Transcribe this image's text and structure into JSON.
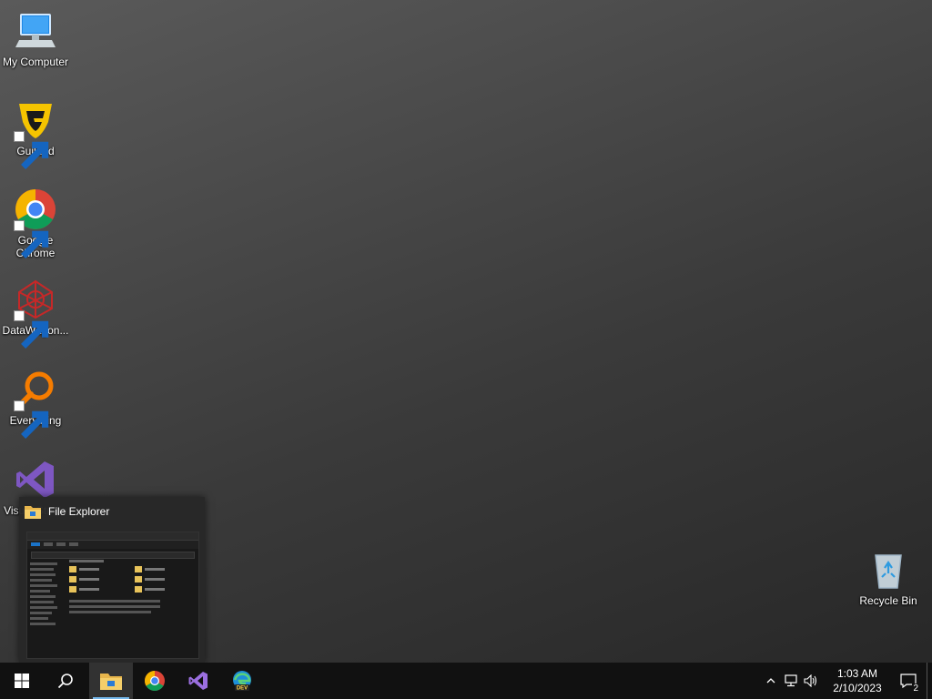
{
  "desktop": {
    "icons": [
      {
        "label": "My Computer",
        "icon": "computer-icon"
      },
      {
        "label": "Guilded",
        "icon": "guilded-icon"
      },
      {
        "label": "Google Chrome",
        "icon": "chrome-icon"
      },
      {
        "label": "DataWagon...",
        "icon": "datawagon-icon"
      },
      {
        "label": "Everything",
        "icon": "everything-icon"
      },
      {
        "label": "Visual Studio",
        "icon": "visual-studio-icon"
      },
      {
        "label": "Recycle Bin",
        "icon": "recycle-bin-icon"
      }
    ]
  },
  "preview": {
    "title": "File Explorer",
    "thumbnail_sections": [
      "Frequent folders",
      "Recent files"
    ]
  },
  "taskbar": {
    "items": [
      {
        "name": "start",
        "icon": "windows-logo-icon"
      },
      {
        "name": "search",
        "icon": "search-icon"
      },
      {
        "name": "file-explorer",
        "icon": "folder-icon",
        "state": "active"
      },
      {
        "name": "chrome",
        "icon": "chrome-icon"
      },
      {
        "name": "visual-studio",
        "icon": "visual-studio-icon"
      },
      {
        "name": "edge-dev",
        "icon": "edge-dev-icon",
        "badge": "DEV"
      }
    ],
    "tray": {
      "icons": [
        "chevron-up-icon",
        "network-icon",
        "volume-icon"
      ],
      "time": "1:03 AM",
      "date": "2/10/2023",
      "notifications": "2"
    }
  },
  "colors": {
    "taskbar": "#111111",
    "accent": "#76b9ed"
  }
}
